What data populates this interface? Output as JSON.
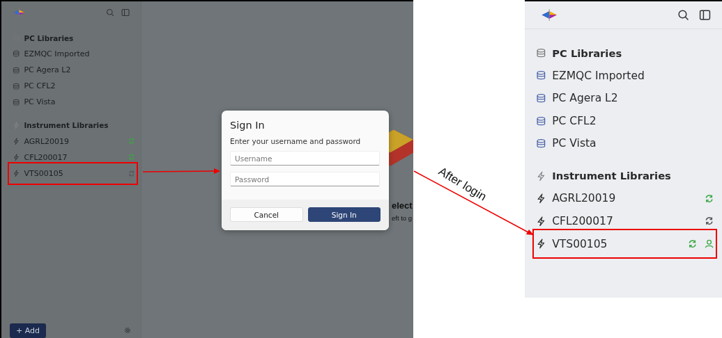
{
  "before_login": {
    "sidebar": {
      "sections": [
        {
          "title": "PC Libraries",
          "kind": "pc",
          "items": [
            {
              "name": "EZMQC Imported"
            },
            {
              "name": "PC Agera L2"
            },
            {
              "name": "PC CFL2"
            },
            {
              "name": "PC Vista"
            }
          ]
        },
        {
          "title": "Instrument Libraries",
          "kind": "instrument",
          "items": [
            {
              "name": "AGRL20019",
              "synced": true,
              "signed_in": false,
              "highlighted": false
            },
            {
              "name": "CFL200017",
              "synced": true,
              "signed_in": false,
              "highlighted": false
            },
            {
              "name": "VTS00105",
              "synced": false,
              "signed_in": false,
              "highlighted": true
            }
          ]
        }
      ],
      "add_button": "+ Add"
    },
    "background_text": [
      "elect",
      "eft to g"
    ],
    "dialog": {
      "title": "Sign In",
      "subtitle": "Enter your username and password",
      "fields": [
        {
          "placeholder": "Username"
        },
        {
          "placeholder": "Password"
        }
      ],
      "buttons": [
        {
          "label": "Cancel",
          "kind": "secondary"
        },
        {
          "label": "Sign In",
          "kind": "primary"
        }
      ]
    }
  },
  "annotation": "After login",
  "after_login": {
    "sidebar": {
      "sections": [
        {
          "title": "PC Libraries",
          "kind": "pc",
          "items": [
            {
              "name": "EZMQC Imported"
            },
            {
              "name": "PC Agera L2"
            },
            {
              "name": "PC CFL2"
            },
            {
              "name": "PC Vista"
            }
          ]
        },
        {
          "title": "Instrument Libraries",
          "kind": "instrument",
          "items": [
            {
              "name": "AGRL20019",
              "synced": true,
              "signed_in": false,
              "highlighted": false
            },
            {
              "name": "CFL200017",
              "synced": false,
              "signed_in": false,
              "highlighted": false
            },
            {
              "name": "VTS00105",
              "synced": true,
              "signed_in": true,
              "highlighted": true
            }
          ]
        }
      ]
    }
  }
}
